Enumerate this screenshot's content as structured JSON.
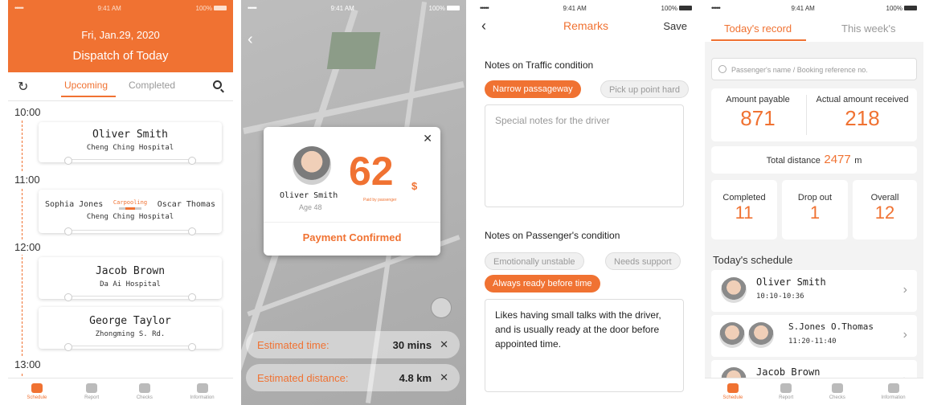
{
  "panel1": {
    "status": {
      "signal": "•••••",
      "time": "9:41 AM",
      "battery": "100%"
    },
    "date": "Fri, Jan.29, 2020",
    "title": "Dispatch of Today",
    "tabs": {
      "upcoming": "Upcoming",
      "completed": "Completed"
    },
    "times": [
      "10:00",
      "11:00",
      "12:00",
      "13:00"
    ],
    "trips": [
      {
        "name": "Oliver Smith",
        "place": "Cheng Ching Hospital"
      },
      {
        "left": "Sophia Jones",
        "badge": "Carpooling",
        "right": "Oscar Thomas",
        "place": "Cheng Ching Hospital"
      },
      {
        "name": "Jacob Brown",
        "place": "Da Ai Hospital"
      },
      {
        "name": "George Taylor",
        "place": "Zhongming S. Rd."
      }
    ]
  },
  "tabbar": [
    "Schedule",
    "Report",
    "Checks",
    "Information"
  ],
  "panel2": {
    "status": {
      "signal": "•••••",
      "time": "9:41 AM",
      "battery": "100%"
    },
    "name": "Oliver Smith",
    "age": "Age 48",
    "amount": "62",
    "currency": "$",
    "paid_by": "Paid by passenger",
    "confirm": "Payment Confirmed",
    "est_time_label": "Estimated time:",
    "est_time_value": "30 mins",
    "est_dist_label": "Estimated distance:",
    "est_dist_value": "4.8 km"
  },
  "panel3": {
    "status": {
      "signal": "•••••",
      "time": "9:41 AM",
      "battery": "100%"
    },
    "title": "Remarks",
    "save": "Save",
    "traffic_title": "Notes on Traffic condition",
    "traffic_chips": [
      "Narrow passageway",
      "Pick up point hard"
    ],
    "traffic_placeholder": "Special notes for the driver",
    "passenger_title": "Notes on Passenger's condition",
    "passenger_chips": [
      "Emotionally unstable",
      "Needs support",
      "Always ready before time"
    ],
    "passenger_note": "Likes having small talks with the driver, and is usually ready at the door before appointed time."
  },
  "panel4": {
    "status": {
      "signal": "•••••",
      "time": "9:41 AM",
      "battery": "100%"
    },
    "tab_today": "Today's record",
    "tab_week": "This week's",
    "search_placeholder": "Passenger's name / Booking reference no.",
    "amount_payable_label": "Amount payable",
    "amount_payable": "871",
    "actual_label": "Actual amount received",
    "actual": "218",
    "distance_label": "Total distance",
    "distance_value": "2477",
    "distance_unit": "m",
    "completed_label": "Completed",
    "completed": "11",
    "dropout_label": "Drop out",
    "dropout": "1",
    "overall_label": "Overall",
    "overall": "12",
    "schedule_title": "Today's schedule",
    "rows": [
      {
        "name": "Oliver Smith",
        "time": "10:10-10:36"
      },
      {
        "name": "S.Jones   O.Thomas",
        "time": "11:20-11:40"
      },
      {
        "name": "Jacob Brown"
      }
    ]
  },
  "colors": {
    "accent": "#f07232"
  }
}
